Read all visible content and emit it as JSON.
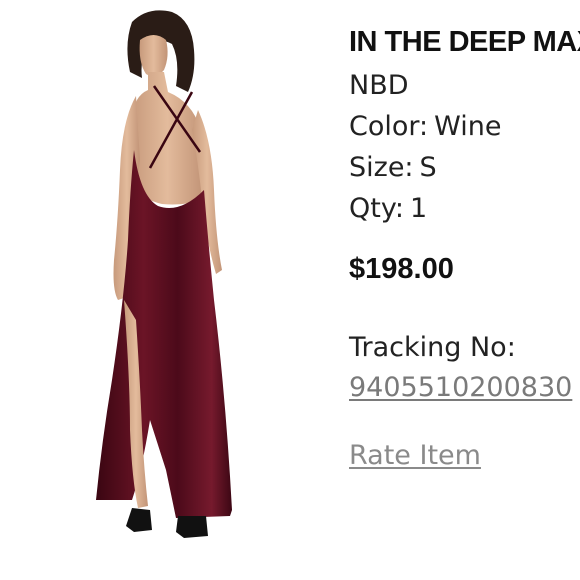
{
  "product": {
    "name": "IN THE DEEP MAXI DRESS",
    "brand": "NBD",
    "color_label": "Color:",
    "color_value": "Wine",
    "size_label": "Size:",
    "size_value": "S",
    "qty_label": "Qty:",
    "qty_value": "1",
    "price": "$198.00",
    "image_icon": "product-photo-icon"
  },
  "shipping": {
    "tracking_label": "Tracking No:",
    "tracking_number": "9405510200830"
  },
  "actions": {
    "rate_item_label": "Rate Item"
  },
  "colors": {
    "dress": "#5a0f1f",
    "link": "#7a7a7a"
  }
}
